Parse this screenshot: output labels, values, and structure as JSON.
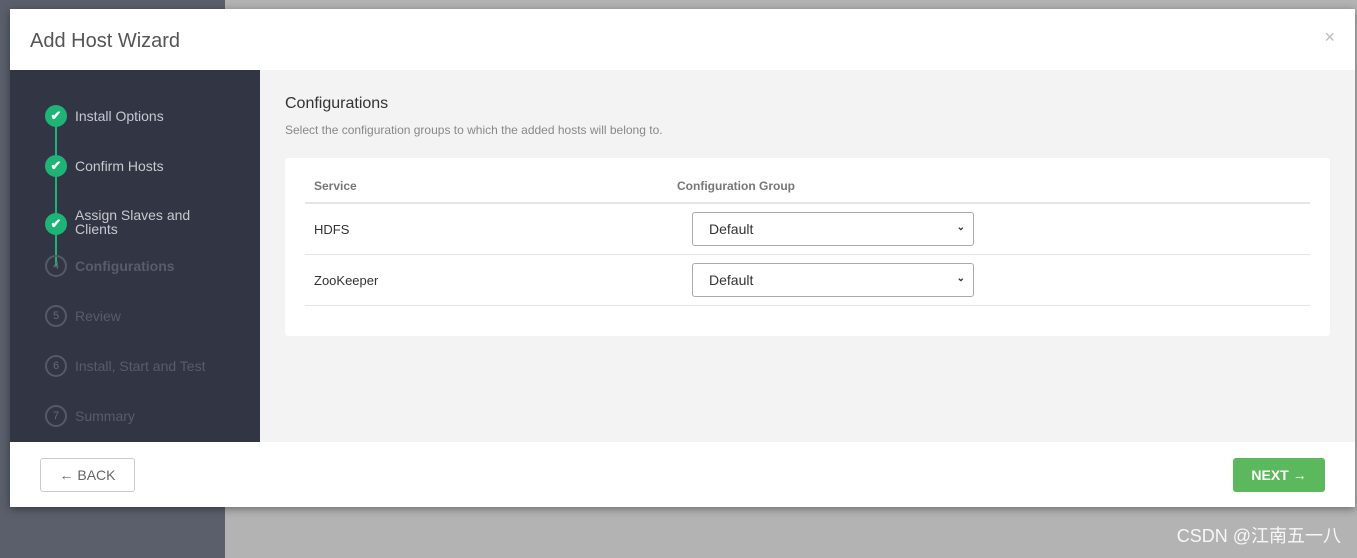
{
  "modal": {
    "title": "Add Host Wizard",
    "close": "×"
  },
  "steps": [
    {
      "num": "✔",
      "label": "Install Options",
      "status": "done"
    },
    {
      "num": "✔",
      "label": "Confirm Hosts",
      "status": "done"
    },
    {
      "num": "✔",
      "label": "Assign Slaves and Clients",
      "status": "done"
    },
    {
      "num": "4",
      "label": "Configurations",
      "status": "current"
    },
    {
      "num": "5",
      "label": "Review",
      "status": "todo"
    },
    {
      "num": "6",
      "label": "Install, Start and Test",
      "status": "todo"
    },
    {
      "num": "7",
      "label": "Summary",
      "status": "todo"
    }
  ],
  "main": {
    "heading": "Configurations",
    "subtitle": "Select the configuration groups to which the added hosts will belong to.",
    "columns": [
      "Service",
      "Configuration Group"
    ],
    "rows": [
      {
        "service": "HDFS",
        "group": "Default"
      },
      {
        "service": "ZooKeeper",
        "group": "Default"
      }
    ]
  },
  "footer": {
    "back": "← BACK",
    "next": "NEXT →"
  },
  "watermark": "CSDN @江南五一八",
  "colors": {
    "accent": "#1eb475",
    "next": "#5cb85c",
    "sidebar": "#323544"
  }
}
